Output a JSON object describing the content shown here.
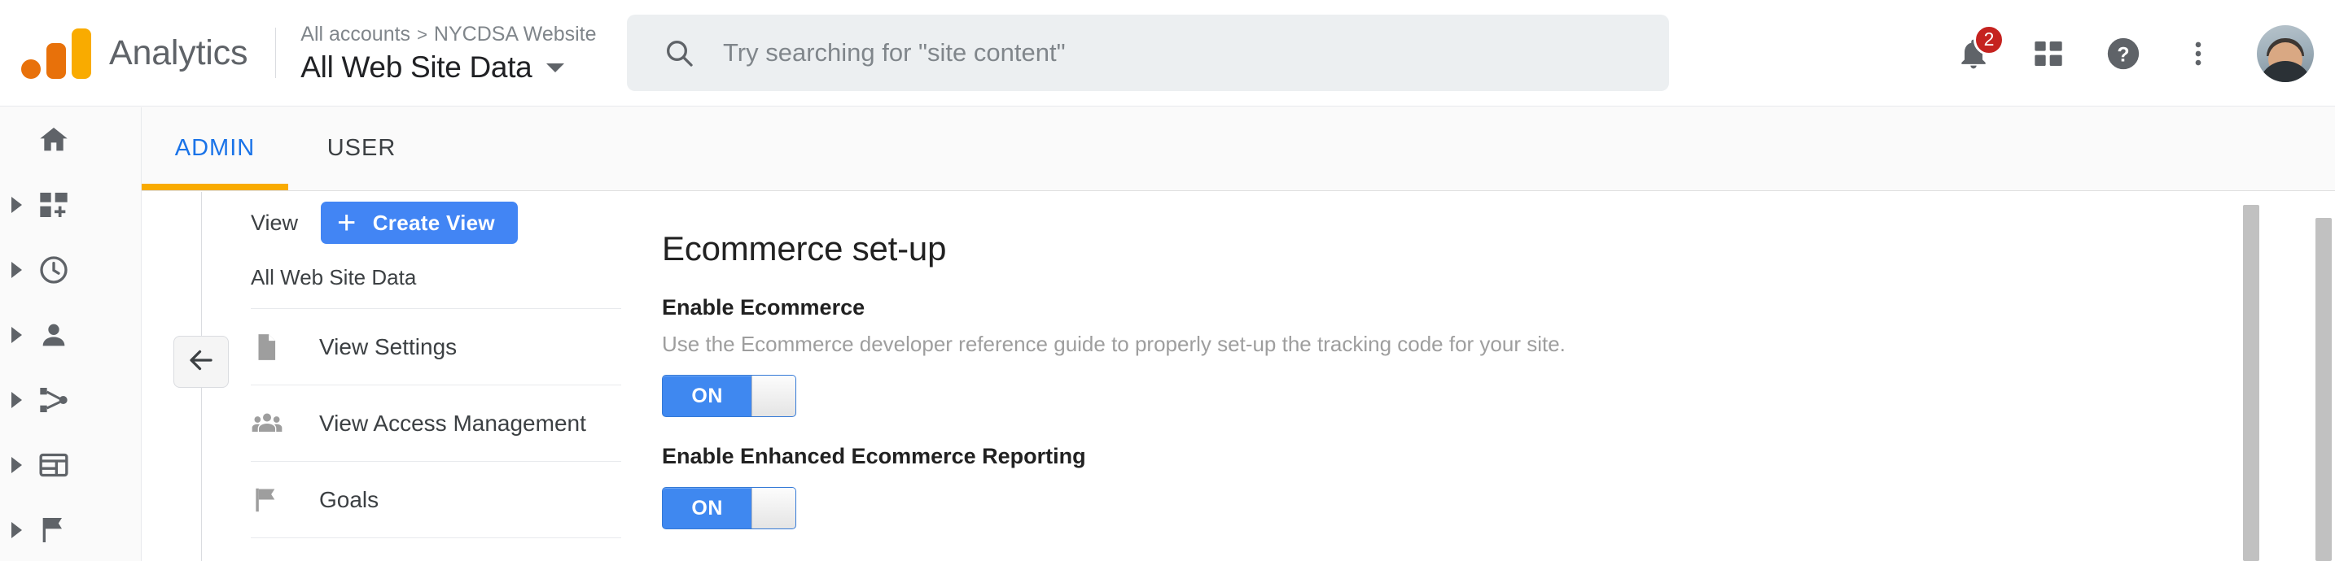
{
  "header": {
    "brand": "Analytics",
    "logo_icon": "analytics-bars-icon",
    "breadcrumb": {
      "account": "All accounts",
      "separator": ">",
      "property": "NYCDSA Website"
    },
    "view_name": "All Web Site Data",
    "view_caret_icon": "chevron-down-icon",
    "search": {
      "icon": "search-icon",
      "placeholder": "Try searching for \"site content\"",
      "value": ""
    },
    "actions": [
      {
        "name": "notifications-bell-icon",
        "badge": "2"
      },
      {
        "name": "apps-grid-icon",
        "badge": ""
      },
      {
        "name": "help-question-icon",
        "badge": ""
      },
      {
        "name": "more-vert-icon",
        "badge": ""
      }
    ],
    "avatar_label": "User account"
  },
  "tabs": [
    {
      "label": "ADMIN",
      "active": true
    },
    {
      "label": "USER",
      "active": false
    }
  ],
  "rail": [
    {
      "name": "home-icon",
      "expandable": false
    },
    {
      "name": "customization-icon",
      "expandable": true
    },
    {
      "name": "realtime-clock-icon",
      "expandable": true
    },
    {
      "name": "audience-person-icon",
      "expandable": true
    },
    {
      "name": "acquisition-share-icon",
      "expandable": true
    },
    {
      "name": "behavior-window-icon",
      "expandable": true
    },
    {
      "name": "conversions-flag-icon",
      "expandable": true
    }
  ],
  "view_panel": {
    "column_label": "View",
    "create_button": {
      "label": "Create View",
      "plus_icon": "plus-icon"
    },
    "selected_view": "All Web Site Data",
    "back_button_icon": "arrow-left-icon",
    "items": [
      {
        "label": "View Settings",
        "icon": "document-icon"
      },
      {
        "label": "View Access Management",
        "icon": "people-icon"
      },
      {
        "label": "Goals",
        "icon": "flag-icon"
      }
    ]
  },
  "main": {
    "title": "Ecommerce set-up",
    "settings": [
      {
        "label": "Enable Ecommerce",
        "description": "Use the Ecommerce developer reference guide to properly set-up the tracking code for your site.",
        "toggle_state": "ON"
      },
      {
        "label": "Enable Enhanced Ecommerce Reporting",
        "description": "",
        "toggle_state": "ON"
      }
    ]
  },
  "colors": {
    "accent_blue": "#1a73e8",
    "tab_underline_orange": "#f9ab00",
    "button_blue": "#4285f4",
    "toggle_blue": "#3f88f0",
    "badge_red": "#c5221f",
    "logo_orange": "#e8710a",
    "logo_amber": "#f9ab00"
  }
}
